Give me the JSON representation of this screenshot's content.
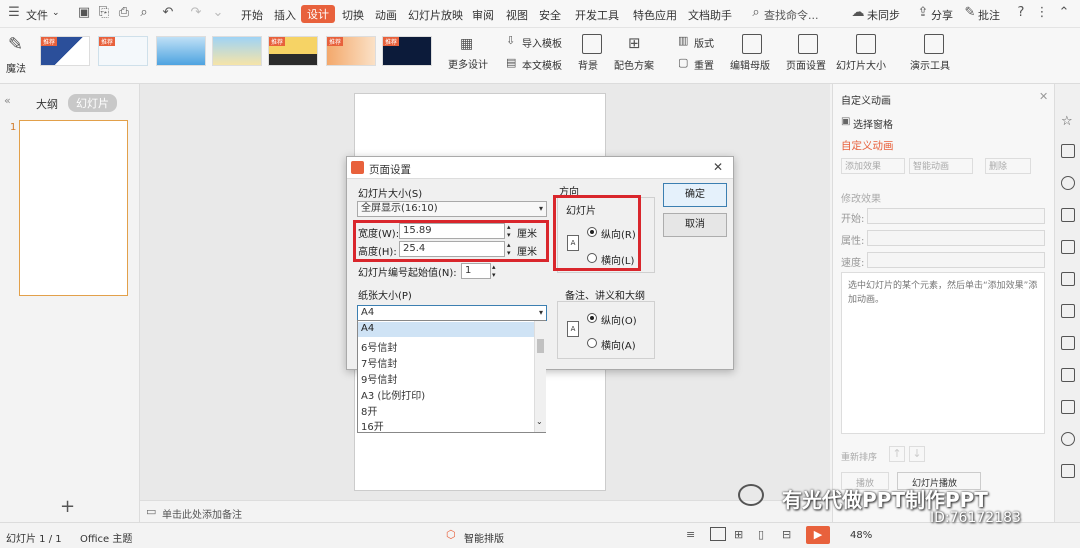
{
  "menubar": {
    "file_label": "文件",
    "tabs": [
      "开始",
      "插入",
      "设计",
      "切换",
      "动画",
      "幻灯片放映",
      "审阅",
      "视图",
      "安全",
      "开发工具",
      "特色应用",
      "文档助手"
    ],
    "active_tab": "设计",
    "search_placeholder": "查找命令...",
    "sync_label": "未同步",
    "share_label": "分享",
    "comment_label": "批注"
  },
  "ribbon": {
    "magic_label": "魔法",
    "theme_badge": "推荐",
    "more_design_label": "更多设计",
    "import_template_label": "导入模板",
    "this_template_label": "本文模板",
    "background_label": "背景",
    "color_scheme_label": "配色方案",
    "layout_label": "版式",
    "reset_label": "重置",
    "edit_master_label": "编辑母版",
    "page_setup_label": "页面设置",
    "slide_size_label": "幻灯片大小",
    "presentation_tools_label": "演示工具"
  },
  "leftpanel": {
    "outline_tab": "大纲",
    "slides_tab": "幻灯片",
    "slide_number": "1"
  },
  "canvas": {
    "notes_placeholder": "单击此处添加备注"
  },
  "rightpanel": {
    "title": "自定义动画",
    "selection_pane": "选择窗格",
    "custom_animation_link": "自定义动画",
    "add_effect": "添加效果",
    "smart_animation": "智能动画",
    "delete": "删除",
    "modify_effect": "修改效果",
    "start_label": "开始:",
    "property_label": "属性:",
    "speed_label": "速度:",
    "hint": "选中幻灯片的某个元素，然后单击“添加效果”添加动画。",
    "reorder_label": "重新排序",
    "play_label": "播放",
    "slideshow_label": "幻灯片播放"
  },
  "statusbar": {
    "slide_info": "幻灯片 1 / 1",
    "theme": "Office 主题",
    "smart_layout": "智能排版",
    "zoom": "48%"
  },
  "dialog": {
    "title": "页面设置",
    "slide_size_label": "幻灯片大小(S)",
    "slide_size_value": "全屏显示(16:10)",
    "width_label": "宽度(W):",
    "width_value": "15.89",
    "height_label": "高度(H):",
    "height_value": "25.4",
    "unit": "厘米",
    "numbering_label": "幻灯片编号起始值(N):",
    "numbering_value": "1",
    "paper_size_label": "纸张大小(P)",
    "paper_size_value": "A4",
    "orientation_label": "方向",
    "slides_group": "幻灯片",
    "portrait_label": "纵向(R)",
    "landscape_label": "横向(L)",
    "notes_group": "备注、讲义和大纲",
    "notes_portrait_label": "纵向(O)",
    "notes_landscape_label": "横向(A)",
    "ok_label": "确定",
    "cancel_label": "取消",
    "paper_options": [
      "A4",
      "6号信封",
      "7号信封",
      "9号信封",
      "A3 (比例打印)",
      "8开",
      "16开"
    ]
  },
  "watermark": {
    "text": "有光代做PPT制作PPT",
    "id_text": "ID:76172183"
  }
}
